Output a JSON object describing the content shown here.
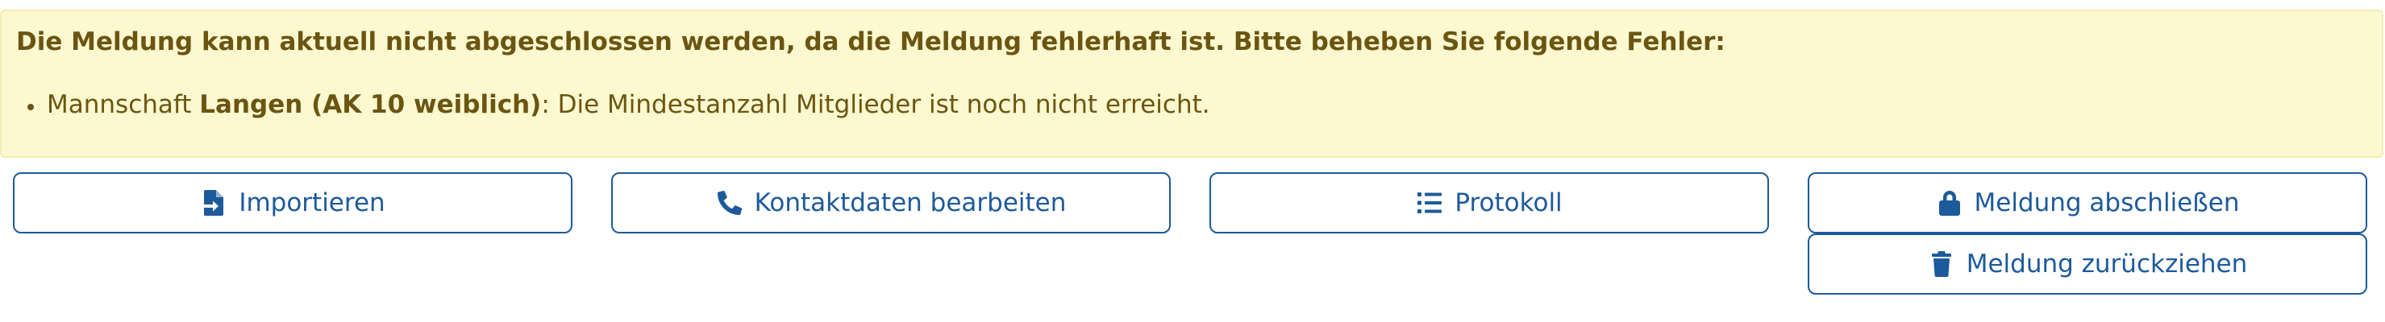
{
  "alert": {
    "heading": "Die Meldung kann aktuell nicht abgeschlossen werden, da die Meldung fehlerhaft ist. Bitte beheben Sie folgende Fehler:",
    "errors": [
      {
        "prefix": "Mannschaft ",
        "team": "Langen (AK 10 weiblich)",
        "message": ": Die Mindestanzahl Mitglieder ist noch nicht erreicht."
      }
    ],
    "colors": {
      "background": "#fcf8cf",
      "text": "#6b5512"
    }
  },
  "actions": {
    "import_label": "Importieren",
    "import_icon": "file-import-icon",
    "contact_label": "Kontaktdaten bearbeiten",
    "contact_icon": "phone-icon",
    "protocol_label": "Protokoll",
    "protocol_icon": "list-icon",
    "finish_label": "Meldung abschließen",
    "finish_icon": "lock-icon",
    "withdraw_label": "Meldung zurückziehen",
    "withdraw_icon": "trash-icon",
    "accent_color": "#1d5a9b"
  }
}
